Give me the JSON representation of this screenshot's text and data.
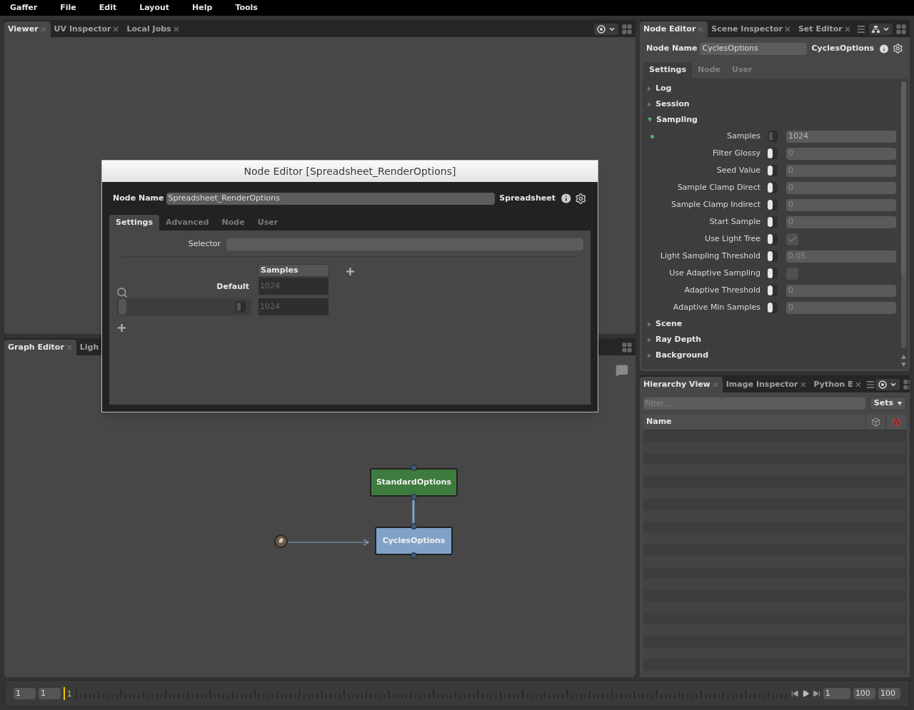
{
  "menu": [
    "Gaffer",
    "File",
    "Edit",
    "Layout",
    "Help",
    "Tools"
  ],
  "viewer": {
    "tabs": [
      {
        "label": "Viewer",
        "selected": true
      },
      {
        "label": "UV Inspector",
        "selected": false
      },
      {
        "label": "Local Jobs",
        "selected": false
      }
    ]
  },
  "graph_editor": {
    "tabs": [
      {
        "label": "Graph Editor",
        "selected": true
      },
      {
        "label": "Ligh",
        "selected": false,
        "closable": false
      }
    ],
    "nodes": [
      {
        "label": "StandardOptions",
        "color": "#3e7b3e"
      },
      {
        "label": "CyclesOptions",
        "color": "#7fa2c6"
      }
    ],
    "dot": "#"
  },
  "node_editor": {
    "tabs": [
      {
        "label": "Node Editor",
        "selected": true
      },
      {
        "label": "Scene Inspector",
        "selected": false
      },
      {
        "label": "Set Editor",
        "selected": false
      }
    ],
    "name_label": "Node Name",
    "name_value": "CyclesOptions",
    "node_type": "CyclesOptions",
    "sub_tabs": [
      {
        "label": "Settings",
        "selected": true
      },
      {
        "label": "Node",
        "selected": false
      },
      {
        "label": "User",
        "selected": false
      }
    ],
    "sections": [
      {
        "label": "Log",
        "expanded": false
      },
      {
        "label": "Session",
        "expanded": false
      },
      {
        "label": "Sampling",
        "expanded": true,
        "plugs": [
          {
            "label": "Samples",
            "kind": "number",
            "value": "1024",
            "enabled": true,
            "modified": true
          },
          {
            "label": "Filter Glossy",
            "kind": "number",
            "value": "0",
            "enabled": false,
            "modified": false
          },
          {
            "label": "Seed Value",
            "kind": "number",
            "value": "0",
            "enabled": false,
            "modified": false
          },
          {
            "label": "Sample Clamp Direct",
            "kind": "number",
            "value": "0",
            "enabled": false,
            "modified": false
          },
          {
            "label": "Sample Clamp Indirect",
            "kind": "number",
            "value": "0",
            "enabled": false,
            "modified": false
          },
          {
            "label": "Start Sample",
            "kind": "number",
            "value": "0",
            "enabled": false,
            "modified": false
          },
          {
            "label": "Use Light Tree",
            "kind": "checkbox",
            "checked": true,
            "enabled": false,
            "modified": false
          },
          {
            "label": "Light Sampling Threshold",
            "kind": "number",
            "value": "0.05",
            "enabled": false,
            "modified": false
          },
          {
            "label": "Use Adaptive Sampling",
            "kind": "checkbox",
            "checked": false,
            "enabled": false,
            "modified": false
          },
          {
            "label": "Adaptive Threshold",
            "kind": "number",
            "value": "0",
            "enabled": false,
            "modified": false
          },
          {
            "label": "Adaptive Min Samples",
            "kind": "number",
            "value": "0",
            "enabled": false,
            "modified": false
          }
        ]
      },
      {
        "label": "Scene",
        "expanded": false
      },
      {
        "label": "Ray Depth",
        "expanded": false
      },
      {
        "label": "Background",
        "expanded": false
      }
    ]
  },
  "hierarchy": {
    "tabs": [
      {
        "label": "Hierarchy View",
        "selected": true
      },
      {
        "label": "Image Inspector",
        "selected": false
      },
      {
        "label": "Python E",
        "selected": false
      }
    ],
    "filter_placeholder": "Filter...",
    "sets_button": "Sets",
    "columns": [
      "Name"
    ]
  },
  "timeline": {
    "range_start": "1",
    "playback_start": "1",
    "current_frame": "1",
    "frame_field": "1",
    "playback_end": "100",
    "range_end": "100"
  },
  "dialog": {
    "title": "Node Editor [Spreadsheet_RenderOptions]",
    "name_label": "Node Name",
    "name_value": "Spreadsheet_RenderOptions",
    "node_type": "Spreadsheet",
    "tabs": [
      {
        "label": "Settings",
        "selected": true
      },
      {
        "label": "Advanced",
        "selected": false
      },
      {
        "label": "Node",
        "selected": false
      },
      {
        "label": "User",
        "selected": false
      }
    ],
    "selector_label": "Selector",
    "columns": [
      "Samples"
    ],
    "rows": [
      {
        "kind": "default",
        "name": "Default",
        "cells": [
          "1024"
        ]
      },
      {
        "kind": "row",
        "enabled": true,
        "cells": [
          "1024"
        ]
      }
    ]
  }
}
